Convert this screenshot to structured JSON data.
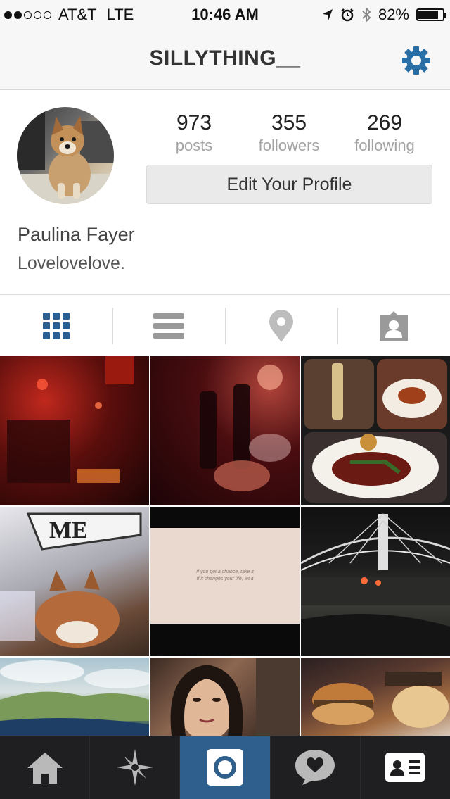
{
  "status_bar": {
    "carrier": "AT&T",
    "network": "LTE",
    "time": "10:46 AM",
    "battery": "82%",
    "battery_level": 0.82,
    "signal_bars_filled": 2,
    "signal_bars_total": 5,
    "icons": [
      "location-arrow-icon",
      "alarm-icon",
      "bluetooth-icon",
      "battery-icon"
    ]
  },
  "nav": {
    "title": "SILLYTHING__",
    "settings_icon": "gear-icon",
    "accent_color": "#2a6ea6"
  },
  "profile": {
    "avatar_icon": "avatar",
    "stats": [
      {
        "count": "973",
        "label": "posts"
      },
      {
        "count": "355",
        "label": "followers"
      },
      {
        "count": "269",
        "label": "following"
      }
    ],
    "edit_button_label": "Edit Your Profile",
    "full_name": "Paulina Fayer",
    "bio": "Lovelovelove."
  },
  "view_tabs": [
    {
      "icon": "grid-icon",
      "active": true,
      "color": "#2a5f93"
    },
    {
      "icon": "list-icon",
      "active": false,
      "color": "#9a9a9a"
    },
    {
      "icon": "map-pin-icon",
      "active": false,
      "color": "#bdbdbd"
    },
    {
      "icon": "tagged-photos-icon",
      "active": false,
      "color": "#9a9a9a"
    }
  ],
  "photos": {
    "quote_lines": [
      "If you get a chance, take it",
      "If it changes your life, let it"
    ],
    "items": [
      "photo-1",
      "photo-2",
      "photo-3",
      "photo-4",
      "photo-5",
      "photo-6",
      "photo-7",
      "photo-8",
      "photo-9"
    ]
  },
  "tab_bar": {
    "items": [
      {
        "icon": "home-icon",
        "active": false
      },
      {
        "icon": "explore-icon",
        "active": false
      },
      {
        "icon": "camera-icon",
        "active": true
      },
      {
        "icon": "activity-icon",
        "active": false
      },
      {
        "icon": "profile-card-icon",
        "active": false
      }
    ],
    "active_color": "#2f5f8d",
    "background": "#1f1f21"
  }
}
